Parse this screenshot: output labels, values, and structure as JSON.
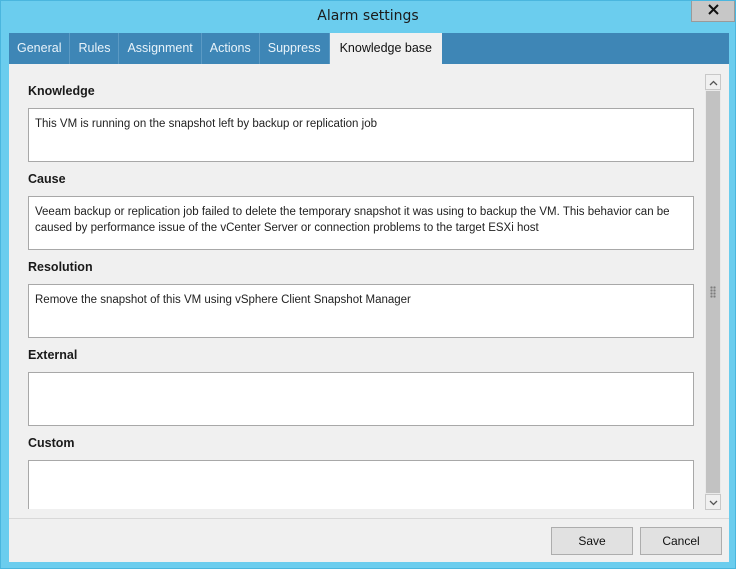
{
  "window": {
    "title": "Alarm settings"
  },
  "tabs": [
    {
      "label": "General",
      "active": false
    },
    {
      "label": "Rules",
      "active": false
    },
    {
      "label": "Assignment",
      "active": false
    },
    {
      "label": "Actions",
      "active": false
    },
    {
      "label": "Suppress",
      "active": false
    },
    {
      "label": "Knowledge base",
      "active": true
    }
  ],
  "sections": {
    "knowledge": {
      "label": "Knowledge",
      "value": "This VM is running on the snapshot left by backup or replication job"
    },
    "cause": {
      "label": "Cause",
      "value": "Veeam backup or replication job failed to delete the temporary snapshot it was using to backup the VM. This behavior can be caused by performance issue of the vCenter Server or connection problems to the target ESXi host"
    },
    "resolution": {
      "label": "Resolution",
      "value": "Remove the snapshot of this VM using vSphere Client Snapshot Manager"
    },
    "external": {
      "label": "External",
      "value": ""
    },
    "custom": {
      "label": "Custom",
      "value": ""
    }
  },
  "footer": {
    "save_label": "Save",
    "cancel_label": "Cancel"
  },
  "icons": {
    "close": "close-icon",
    "scroll_up": "chevron-up-icon",
    "scroll_down": "chevron-down-icon"
  },
  "colors": {
    "titlebar": "#6bcdee",
    "tab_strip": "#3e86b6",
    "close_button": "#c7c7c7"
  }
}
